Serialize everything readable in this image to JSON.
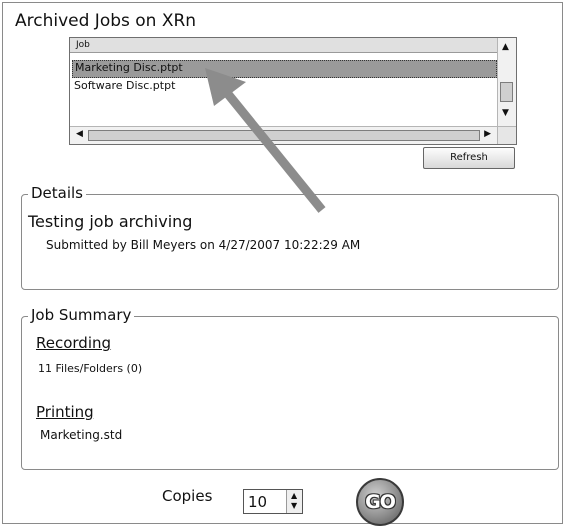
{
  "window": {
    "title": "Archived Jobs on XRn"
  },
  "job_list": {
    "column_header": "Job",
    "rows": [
      "Marketing Disc.ptpt",
      "Software Disc.ptpt"
    ],
    "selected_index": 0
  },
  "buttons": {
    "refresh": "Refresh",
    "go": "GO"
  },
  "details": {
    "legend": "Details",
    "job_name": "Testing job archiving",
    "submitted": "Submitted by Bill Meyers on 4/27/2007 10:22:29 AM"
  },
  "summary": {
    "legend": "Job Summary",
    "recording_heading": "Recording",
    "recording_value": "11 Files/Folders (0)",
    "printing_heading": "Printing",
    "printing_value": "Marketing.std"
  },
  "copies": {
    "label": "Copies",
    "value": "10"
  },
  "colors": {
    "annotation_arrow": "#8c8c8c",
    "selection": "#9a9a9a"
  },
  "icons": [
    "scroll-up-icon",
    "scroll-down-icon",
    "scroll-left-icon",
    "scroll-right-icon",
    "spin-up-icon",
    "spin-down-icon",
    "annotation-arrow"
  ]
}
